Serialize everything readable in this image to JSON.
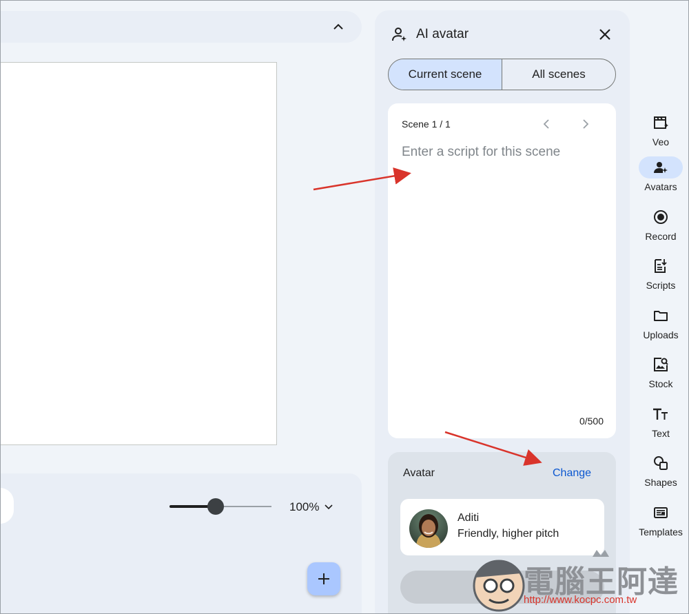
{
  "panel": {
    "title": "AI avatar",
    "tabs": [
      "Current scene",
      "All scenes"
    ],
    "active_tab": "Current scene"
  },
  "script": {
    "scene_label": "Scene 1 / 1",
    "placeholder": "Enter a script for this scene",
    "value": "",
    "counter": "0/500"
  },
  "avatar": {
    "section_label": "Avatar",
    "change_label": "Change",
    "name": "Aditi",
    "description": "Friendly, higher pitch"
  },
  "zoom": {
    "label": "100%",
    "level": 0.45
  },
  "rail": {
    "items": [
      {
        "label": "Veo",
        "icon": "clapperboard-sparkle-icon"
      },
      {
        "label": "Avatars",
        "icon": "person-sparkle-icon"
      },
      {
        "label": "Record",
        "icon": "record-icon"
      },
      {
        "label": "Scripts",
        "icon": "script-icon"
      },
      {
        "label": "Uploads",
        "icon": "folder-icon"
      },
      {
        "label": "Stock",
        "icon": "stock-image-icon"
      },
      {
        "label": "Text",
        "icon": "text-icon"
      },
      {
        "label": "Shapes",
        "icon": "shapes-icon"
      },
      {
        "label": "Templates",
        "icon": "templates-icon"
      }
    ],
    "active": "Avatars"
  },
  "watermark": {
    "title": "電腦王阿達",
    "url": "http://www.kocpc.com.tw"
  },
  "colors": {
    "accent": "#0b57d0",
    "selected": "#d3e3fd",
    "annotation": "#d9342b"
  }
}
